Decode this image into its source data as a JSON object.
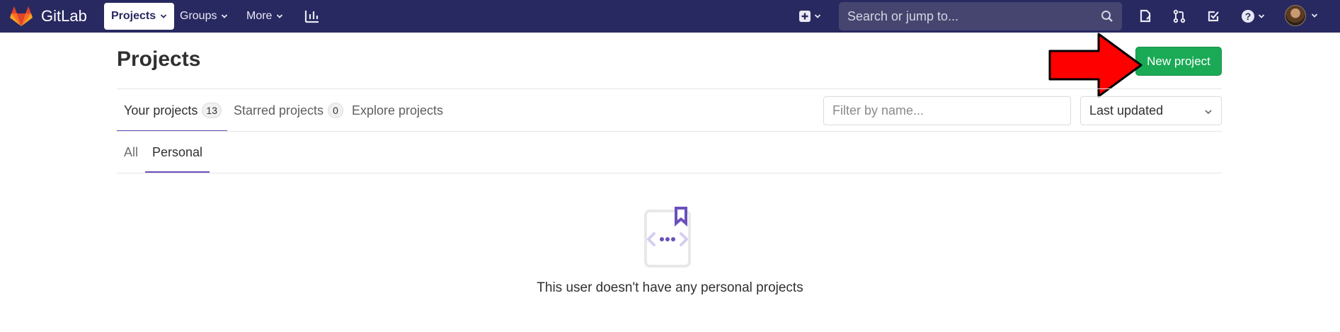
{
  "navbar": {
    "brand": "GitLab",
    "menu": [
      {
        "label": "Projects",
        "active": true
      },
      {
        "label": "Groups",
        "active": false
      },
      {
        "label": "More",
        "active": false
      }
    ],
    "icons": [
      "activity-chart-icon",
      "new-item-icon",
      "issues-icon",
      "merge-requests-icon",
      "todos-icon",
      "help-icon"
    ],
    "search_placeholder": "Search or jump to..."
  },
  "header": {
    "title": "Projects",
    "new_project_label": "New project"
  },
  "tabs": [
    {
      "label": "Your projects",
      "count": "13",
      "active": true
    },
    {
      "label": "Starred projects",
      "count": "0",
      "active": false
    },
    {
      "label": "Explore projects",
      "active": false
    }
  ],
  "filters": {
    "name_placeholder": "Filter by name...",
    "sort_value": "Last updated"
  },
  "subtabs": [
    {
      "label": "All",
      "active": false
    },
    {
      "label": "Personal",
      "active": true
    }
  ],
  "empty_state": {
    "message": "This user doesn't have any personal projects"
  },
  "colors": {
    "navbar": "#292961",
    "primary_action": "#1aaa55",
    "tab_accent": "#6b4fbb",
    "annotation_arrow": "#ff0000"
  }
}
